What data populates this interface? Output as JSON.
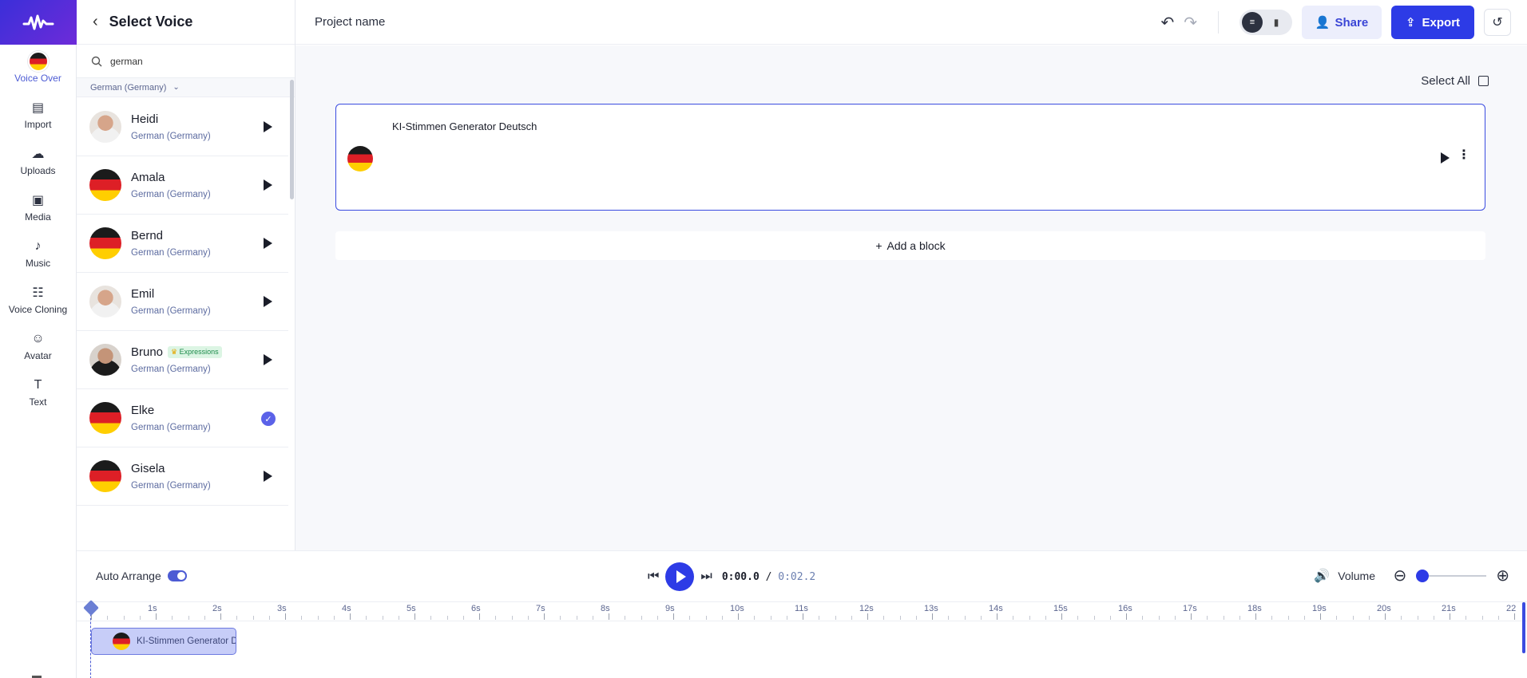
{
  "app": {
    "accent": "#2d3be6"
  },
  "rail": {
    "items": [
      {
        "label": "Voice Over",
        "icon": "german-flag-icon",
        "active": true
      },
      {
        "label": "Import",
        "icon": "import-icon"
      },
      {
        "label": "Uploads",
        "icon": "cloud-upload-icon"
      },
      {
        "label": "Media",
        "icon": "media-icon"
      },
      {
        "label": "Music",
        "icon": "music-note-icon"
      },
      {
        "label": "Voice Cloning",
        "icon": "voice-cloning-icon"
      },
      {
        "label": "Avatar",
        "icon": "avatar-icon"
      },
      {
        "label": "Text",
        "icon": "text-icon"
      }
    ]
  },
  "voice_panel": {
    "title": "Select Voice",
    "search": {
      "value": "german"
    },
    "filter": "German (Germany)",
    "voices": [
      {
        "name": "Heidi",
        "lang": "German (Germany)",
        "avatar": "photo",
        "state": "play"
      },
      {
        "name": "Amala",
        "lang": "German (Germany)",
        "avatar": "flag",
        "state": "play"
      },
      {
        "name": "Bernd",
        "lang": "German (Germany)",
        "avatar": "flag",
        "state": "play"
      },
      {
        "name": "Emil",
        "lang": "German (Germany)",
        "avatar": "photo",
        "state": "play"
      },
      {
        "name": "Bruno",
        "lang": "German (Germany)",
        "avatar": "photo-dark",
        "state": "play",
        "badge": "Expressions"
      },
      {
        "name": "Elke",
        "lang": "German (Germany)",
        "avatar": "flag",
        "state": "selected"
      },
      {
        "name": "Gisela",
        "lang": "German (Germany)",
        "avatar": "flag",
        "state": "play"
      }
    ]
  },
  "topbar": {
    "project_name": "Project name",
    "share_label": "Share",
    "export_label": "Export"
  },
  "editor": {
    "select_all_label": "Select All",
    "block": {
      "text": "KI-Stimmen Generator Deutsch"
    },
    "add_block_label": "Add a block"
  },
  "player": {
    "auto_arrange_label": "Auto Arrange",
    "auto_arrange_on": true,
    "current_time": "0:00.0",
    "separator": "/",
    "total_time": "0:02.2",
    "volume_label": "Volume",
    "zoom_level": 0
  },
  "timeline": {
    "labels": [
      "1s",
      "2s",
      "3s",
      "4s",
      "5s",
      "6s",
      "7s",
      "8s",
      "9s",
      "10s",
      "11s",
      "12s",
      "13s",
      "14s",
      "15s",
      "16s",
      "17s",
      "18s",
      "19s",
      "20s",
      "21s",
      "22"
    ],
    "clip_text": "KI-Stimmen Generator Deutsch"
  }
}
